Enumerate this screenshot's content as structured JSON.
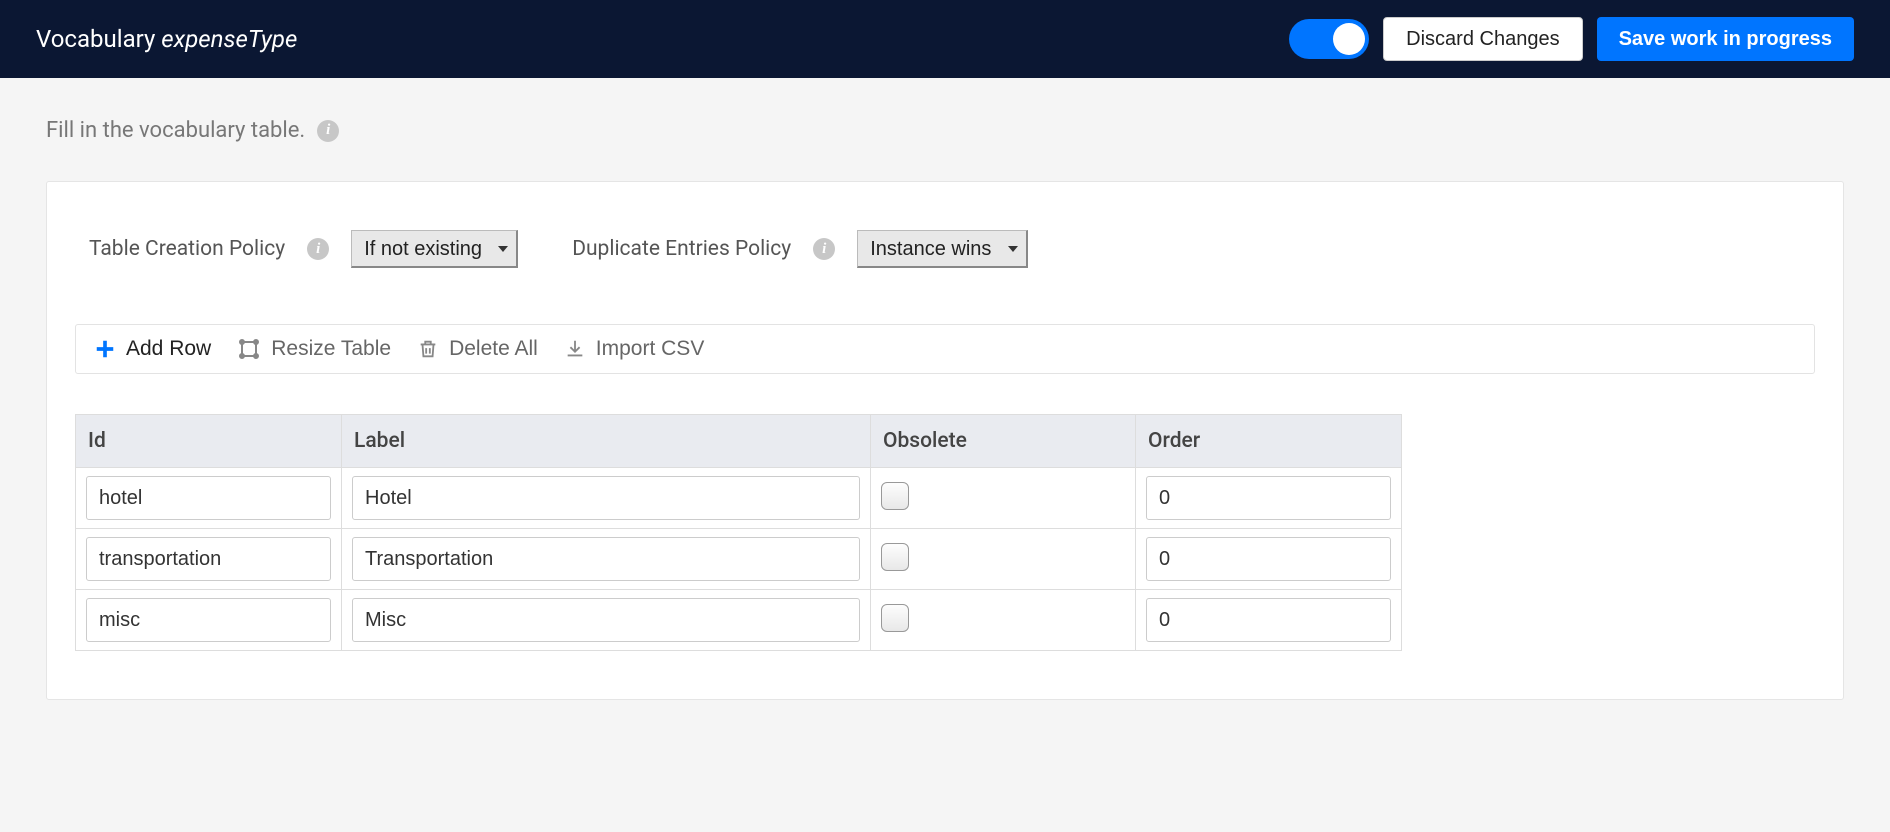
{
  "header": {
    "title_prefix": "Vocabulary",
    "title_name": "expenseType",
    "toggle_on": true,
    "discard_label": "Discard Changes",
    "save_label": "Save work in progress"
  },
  "hint": "Fill in the vocabulary table.",
  "policies": {
    "creation_label": "Table Creation Policy",
    "creation_value": "If not existing",
    "creation_options": [
      "If not existing"
    ],
    "duplicate_label": "Duplicate Entries Policy",
    "duplicate_value": "Instance wins",
    "duplicate_options": [
      "Instance wins"
    ]
  },
  "toolbar": {
    "add_row": "Add Row",
    "resize": "Resize Table",
    "delete_all": "Delete All",
    "import_csv": "Import CSV"
  },
  "table": {
    "columns": {
      "id": "Id",
      "label": "Label",
      "obsolete": "Obsolete",
      "order": "Order"
    },
    "rows": [
      {
        "id": "hotel",
        "label": "Hotel",
        "obsolete": false,
        "order": "0"
      },
      {
        "id": "transportation",
        "label": "Transportation",
        "obsolete": false,
        "order": "0"
      },
      {
        "id": "misc",
        "label": "Misc",
        "obsolete": false,
        "order": "0"
      }
    ]
  }
}
